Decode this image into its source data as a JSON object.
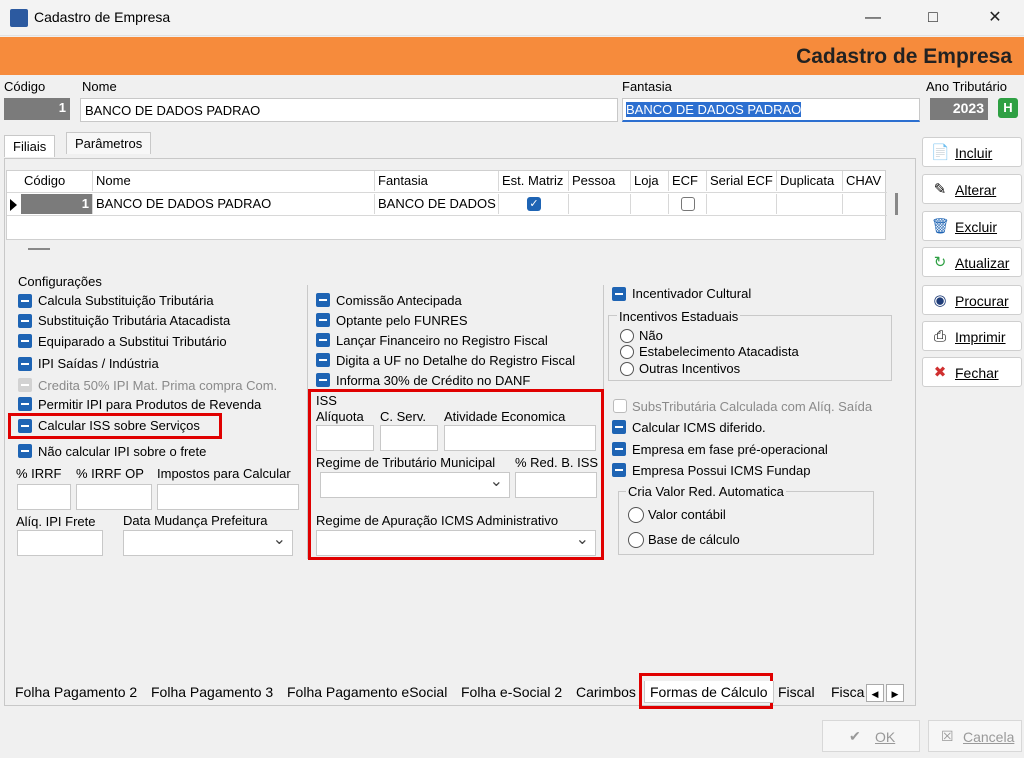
{
  "window": {
    "title": "Cadastro de Empresa"
  },
  "banner": {
    "title": "Cadastro de Empresa"
  },
  "header": {
    "codigo_label": "Código",
    "codigo_value": "1",
    "nome_label": "Nome",
    "nome_value": "BANCO DE DADOS PADRAO",
    "fantasia_label": "Fantasia",
    "fantasia_value": "BANCO DE DADOS PADRAO",
    "ano_label": "Ano Tributário",
    "ano_value": "2023",
    "ano_btn": "H"
  },
  "top_tabs": [
    "Filiais",
    "Parâmetros"
  ],
  "grid": {
    "headers": [
      "Código",
      "Nome",
      "Fantasia",
      "Est. Matriz",
      "Pessoa",
      "Loja",
      "ECF",
      "Serial ECF",
      "Duplicata",
      "CHAV"
    ],
    "row": {
      "codigo": "1",
      "nome": "BANCO DE DADOS PADRAO",
      "fantasia": "BANCO DE DADOS",
      "est_matriz": true,
      "ecf": false
    }
  },
  "config": {
    "label": "Configurações",
    "col1": [
      "Calcula Substituição Tributária",
      "Substituição Tributária Atacadista",
      "Equiparado a Substitui Tributário",
      "IPI Saídas / Indústria",
      "Credita 50% IPI Mat. Prima compra Com.",
      "Permitir IPI para Produtos de Revenda",
      "Calcular ISS sobre Serviços",
      "Não calcular IPI sobre o frete"
    ],
    "irrf_label": "% IRRF",
    "irrf_op_label": "% IRRF OP",
    "impostos_label": "Impostos para Calcular",
    "ipi_frete_label": "Alíq. IPI Frete",
    "data_mud_label": "Data Mudança Prefeitura",
    "col2": [
      "Comissão Antecipada",
      "Optante pelo FUNRES",
      "Lançar Financeiro no Registro Fiscal",
      "Digita a UF no Detalhe do Registro Fiscal",
      "Informa 30% de Crédito no DANF"
    ],
    "iss": {
      "label": "ISS",
      "aliquota": "Alíquota",
      "cserv": "C. Serv.",
      "atividade": "Atividade Economica",
      "regime_trib": "Regime de Tributário Municipal",
      "red_iss": "% Red. B. ISS",
      "regime_apur": "Regime de Apuração ICMS Administrativo"
    },
    "col3": {
      "incentivador": "Incentivador Cultural",
      "incentivos_label": "Incentivos Estaduais",
      "incentivos": [
        "Não",
        "Estabelecimento Atacadista",
        "Outras Incentivos"
      ],
      "subs": "SubsTributária Calculada com Alíq. Saída",
      "icms_dif": "Calcular ICMS diferido.",
      "preop": "Empresa em fase pré-operacional",
      "fundap": "Empresa Possui ICMS Fundap",
      "cria_label": "Cria Valor Red. Automatica",
      "cria_opts": [
        "Valor contábil",
        "Base de cálculo"
      ]
    }
  },
  "bottom_tabs": [
    "Folha Pagamento 2",
    "Folha Pagamento 3",
    "Folha Pagamento eSocial",
    "Folha e-Social 2",
    "Carimbos",
    "Formas de Cálculo",
    "Fiscal",
    "Fisca"
  ],
  "side_buttons": [
    "Incluir",
    "Alterar",
    "Excluir",
    "Atualizar",
    "Procurar",
    "Imprimir",
    "Fechar"
  ],
  "footer": {
    "ok": "OK",
    "cancel": "Cancela"
  },
  "colors": {
    "accent": "#f68b3c",
    "highlight": "#e00000",
    "check": "#1e64b4"
  }
}
